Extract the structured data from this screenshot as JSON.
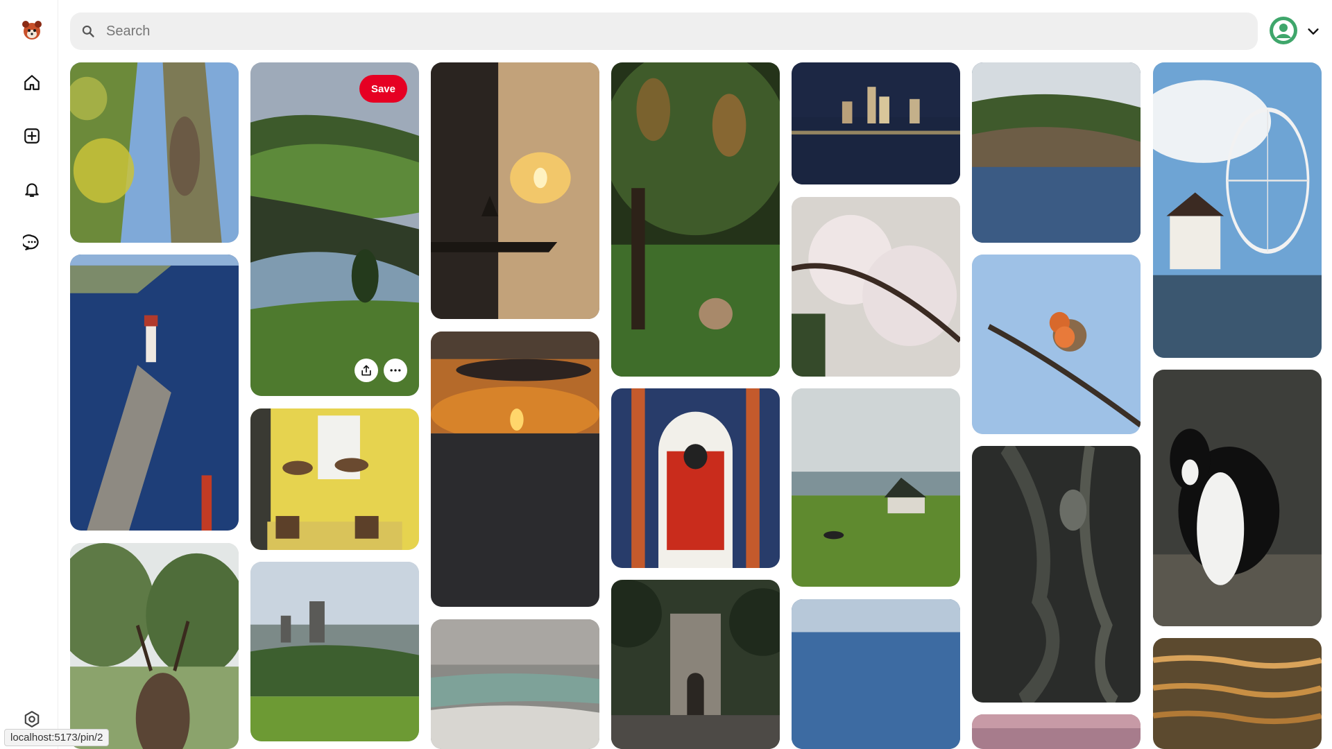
{
  "app": {
    "logo_icon": "red-panda-logo-icon"
  },
  "sidebar": {
    "items": [
      {
        "name": "home",
        "icon": "home-icon"
      },
      {
        "name": "create",
        "icon": "plus-square-icon"
      },
      {
        "name": "notifications",
        "icon": "bell-icon"
      },
      {
        "name": "messages",
        "icon": "chat-bubble-icon"
      }
    ],
    "settings_icon": "gear-icon"
  },
  "search": {
    "placeholder": "Search",
    "value": "",
    "icon": "search-icon"
  },
  "user": {
    "avatar_icon": "user-avatar-icon",
    "menu_icon": "chevron-down-icon",
    "avatar_color": "#3fa66b"
  },
  "hover_pin": {
    "save_label": "Save",
    "share_icon": "share-icon",
    "more_icon": "more-icon"
  },
  "pins": [
    {
      "subject": "squirrel in tree"
    },
    {
      "subject": "lighthouse pier"
    },
    {
      "subject": "stag"
    },
    {
      "subject": "green hillside river"
    },
    {
      "subject": "yellow wall hanging baskets"
    },
    {
      "subject": "cathedral landscape"
    },
    {
      "subject": "sunset reflection"
    },
    {
      "subject": "sunset over sea"
    },
    {
      "subject": "waves"
    },
    {
      "subject": "deer under tree"
    },
    {
      "subject": "red door"
    },
    {
      "subject": "castle gate"
    },
    {
      "subject": "city skyline at night"
    },
    {
      "subject": "cherry blossom"
    },
    {
      "subject": "field with house"
    },
    {
      "subject": "blue sea"
    },
    {
      "subject": "coastal cliff"
    },
    {
      "subject": "robin on branch"
    },
    {
      "subject": "tree bark"
    },
    {
      "subject": "pink sky"
    },
    {
      "subject": "ferris wheel"
    },
    {
      "subject": "black and white cat"
    },
    {
      "subject": "golden water"
    }
  ],
  "status_bar": {
    "url": "localhost:5173/pin/2"
  },
  "colors": {
    "accent": "#e60023",
    "search_bg": "#efefef"
  }
}
